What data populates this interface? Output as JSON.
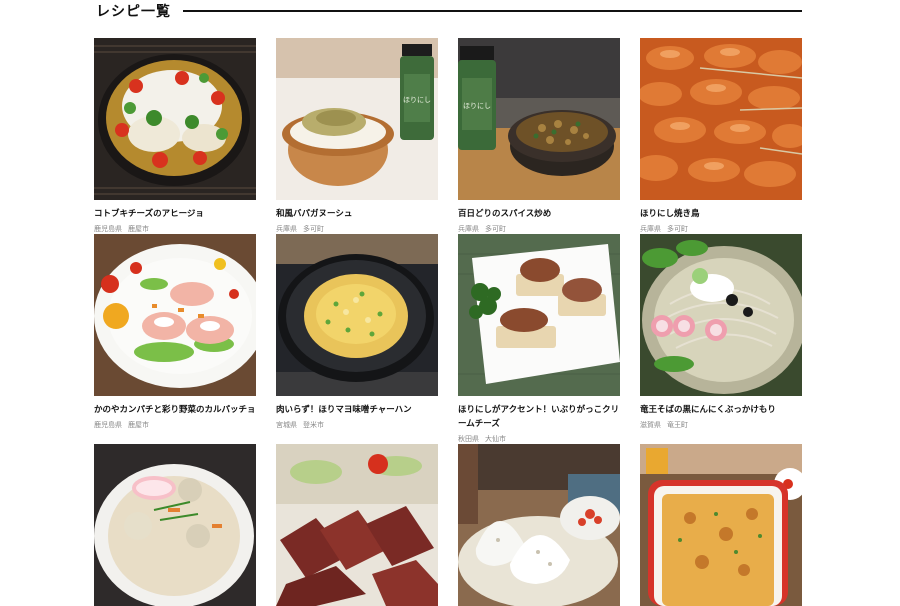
{
  "section": {
    "title": "レシピ一覧"
  },
  "recipes": [
    {
      "title": "コトブキチーズのアヒージョ",
      "prefecture": "鹿児島県",
      "city": "鹿屋市",
      "image": "ajillo-skillet"
    },
    {
      "title": "和風バパガヌーシュ",
      "prefecture": "兵庫県",
      "city": "多可町",
      "image": "baba-ganoush-bowl"
    },
    {
      "title": "百日どりのスパイス炒め",
      "prefecture": "兵庫県",
      "city": "多可町",
      "image": "spice-stirfry-bowl"
    },
    {
      "title": "ほりにし焼き鳥",
      "prefecture": "兵庫県",
      "city": "多可町",
      "image": "yakitori-skewers"
    },
    {
      "title": "かのやカンパチと彩り野菜のカルパッチョ",
      "prefecture": "鹿児島県",
      "city": "鹿屋市",
      "image": "carpaccio-plate"
    },
    {
      "title": "肉いらず！ほりマヨ味噌チャーハン",
      "prefecture": "宮城県",
      "city": "登米市",
      "image": "fried-rice-bowl"
    },
    {
      "title": "ほりにしがアクセント！いぶりがっこクリームチーズ",
      "prefecture": "秋田県",
      "city": "大仙市",
      "image": "iburigakko-plate"
    },
    {
      "title": "竜王そばの黒にんにくぶっかけもり",
      "prefecture": "滋賀県",
      "city": "竜王町",
      "image": "soba-bowl"
    },
    {
      "title": "",
      "prefecture": "",
      "city": "",
      "image": "soup-bowl"
    },
    {
      "title": "",
      "prefecture": "",
      "city": "",
      "image": "roast-beef"
    },
    {
      "title": "",
      "prefecture": "",
      "city": "",
      "image": "rice-balls"
    },
    {
      "title": "",
      "prefecture": "",
      "city": "",
      "image": "gratin-dish"
    }
  ]
}
